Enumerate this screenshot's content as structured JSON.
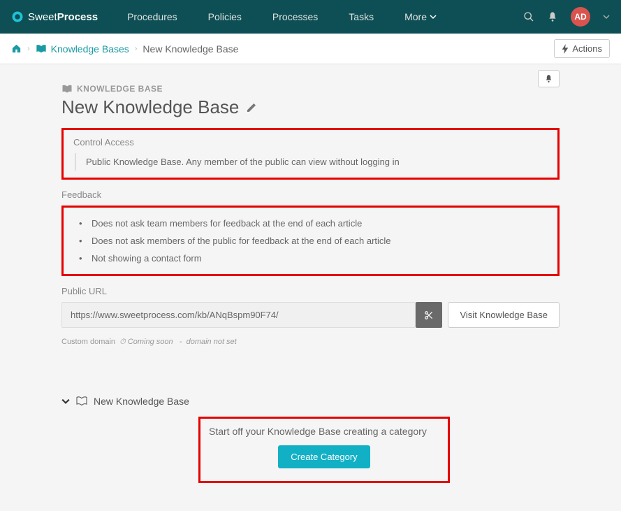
{
  "brand": {
    "prefix": "Sweet",
    "suffix": "Process"
  },
  "nav": {
    "items": [
      "Procedures",
      "Policies",
      "Processes",
      "Tasks"
    ],
    "more": "More"
  },
  "avatar": "AD",
  "breadcrumb": {
    "kb": "Knowledge Bases",
    "current": "New Knowledge Base"
  },
  "actions_btn": "Actions",
  "kb_label": "KNOWLEDGE BASE",
  "page_title": "New Knowledge Base",
  "sections": {
    "access": {
      "label": "Control Access",
      "items": [
        "Public Knowledge Base. Any member of the public can view without logging in"
      ]
    },
    "feedback": {
      "label": "Feedback",
      "items": [
        "Does not ask team members for feedback at the end of each article",
        "Does not ask members of the public for feedback at the end of each article",
        "Not showing a contact form"
      ]
    },
    "url": {
      "label": "Public URL",
      "value": "https://www.sweetprocess.com/kb/ANqBspm90F74/",
      "visit": "Visit Knowledge Base"
    }
  },
  "custom_domain": {
    "label": "Custom domain",
    "coming": "Coming soon",
    "status": "domain not set"
  },
  "tree": {
    "title": "New Knowledge Base",
    "prompt": "Start off your Knowledge Base creating a category",
    "create": "Create Category"
  }
}
